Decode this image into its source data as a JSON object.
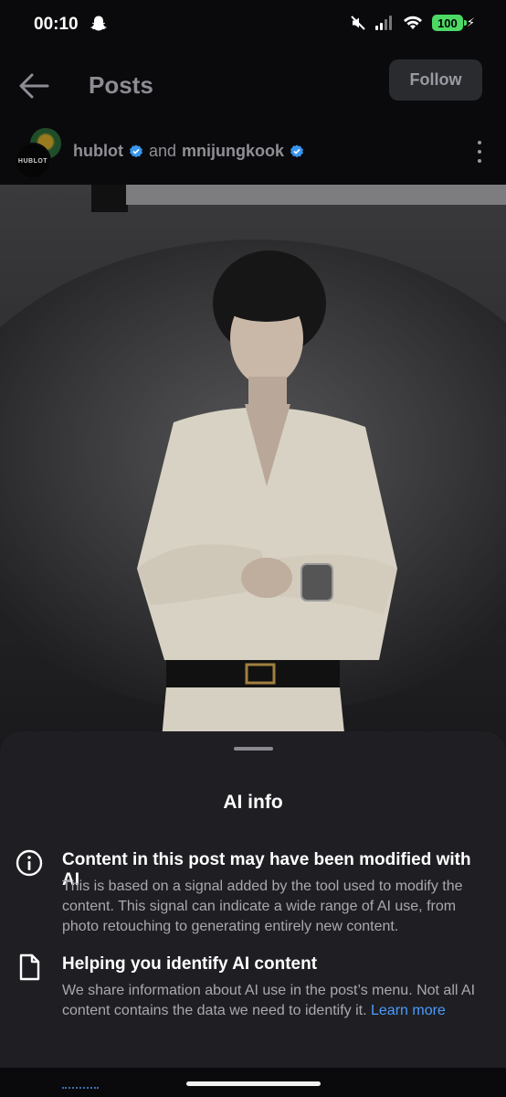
{
  "status_bar": {
    "time": "00:10",
    "battery": "100",
    "icons": [
      "snapchat-icon",
      "mute-icon",
      "signal-icon",
      "wifi-icon",
      "battery-icon"
    ]
  },
  "header": {
    "title": "Posts",
    "follow_label": "Follow"
  },
  "author": {
    "avatar_text": "HUBLOT",
    "user1": "hublot",
    "connector": "and",
    "user2": "mnijungkook"
  },
  "sheet": {
    "title": "AI info",
    "items": [
      {
        "icon": "info-icon",
        "heading": "Content in this post may have been modified with AI",
        "body": "This is based on a signal added by the tool used to modify the content. This signal can indicate a wide range of AI use, from photo retouching to generating entirely new content."
      },
      {
        "icon": "document-icon",
        "heading": "Helping you identify AI content",
        "body": "We share information about AI use in the post’s menu. Not all AI content contains the data we need to identify it. ",
        "link": "Learn more"
      }
    ]
  },
  "colors": {
    "background": "#0a0a0c",
    "sheet": "#1f1f23",
    "link": "#4c9bff",
    "verified": "#3897f0",
    "battery": "#4cd964"
  }
}
